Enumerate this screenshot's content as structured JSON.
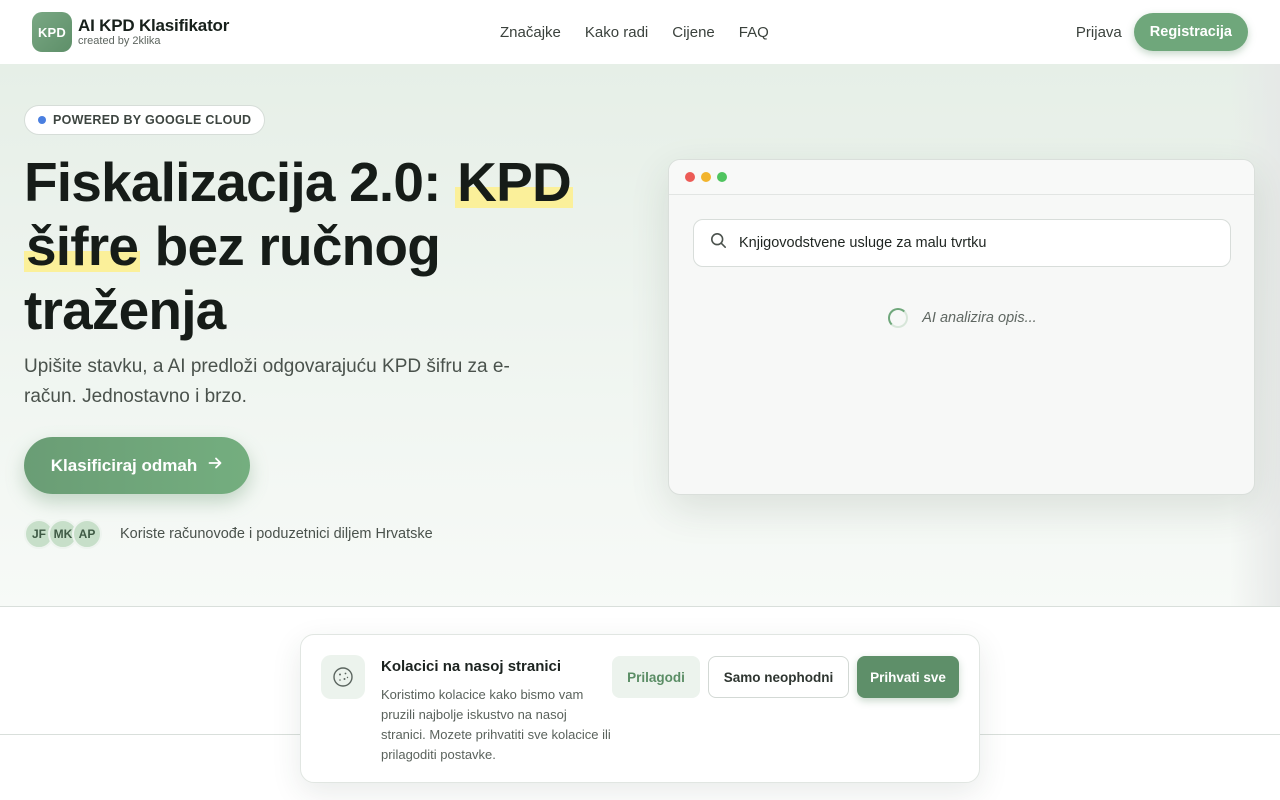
{
  "brand": {
    "logo_text": "KPD",
    "name": "AI KPD Klasifikator",
    "subtitle": "created by 2klika"
  },
  "nav": {
    "items": [
      "Značajke",
      "Kako radi",
      "Cijene",
      "FAQ"
    ],
    "login": "Prijava",
    "register": "Registracija"
  },
  "hero": {
    "badge": "POWERED BY GOOGLE CLOUD",
    "headline_part1": "Fiskalizacija 2.0: ",
    "headline_highlight1": "KPD",
    "headline_highlight2": "šifre",
    "headline_part2": " bez ručnog",
    "headline_part3": "traženja",
    "subtitle": "Upišite stavku, a AI predloži odgovarajuću KPD šifru za e-račun. Jednostavno i brzo.",
    "cta": "Klasificiraj odmah",
    "avatars": [
      "JF",
      "MK",
      "AP"
    ],
    "social_proof": "Koriste računovođe i poduzetnici diljem Hrvatske"
  },
  "demo": {
    "search_value": "Knjigovodstvene usluge za malu tvrtku",
    "status": "AI analizira opis..."
  },
  "cookie": {
    "title": "Kolacici na nasoj stranici",
    "text": "Koristimo kolacice kako bismo vam pruzili najbolje iskustvo na nasoj stranici. Mozete prihvatiti sve kolacice ili prilagoditi postavke.",
    "customize": "Prilagodi",
    "necessary": "Samo neophodni",
    "accept_all": "Prihvati sve"
  },
  "colors": {
    "accent": "#6fa77b",
    "accent_dark": "#5e8f69",
    "highlight": "#fbf09a",
    "badge_dot": "#4a7fe0"
  },
  "icons": {
    "search": "search-icon",
    "arrow": "arrow-right-icon",
    "cookie": "cookie-icon",
    "spinner": "spinner-icon"
  }
}
